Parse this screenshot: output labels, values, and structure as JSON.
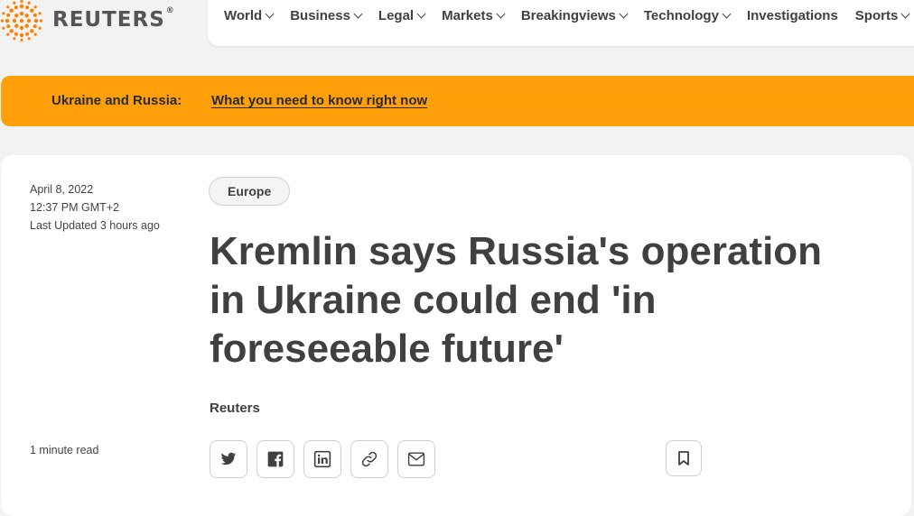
{
  "brand": {
    "name": "REUTERS",
    "reg": "®"
  },
  "nav": {
    "items": [
      {
        "label": "World",
        "dropdown": true
      },
      {
        "label": "Business",
        "dropdown": true
      },
      {
        "label": "Legal",
        "dropdown": true
      },
      {
        "label": "Markets",
        "dropdown": true
      },
      {
        "label": "Breakingviews",
        "dropdown": true
      },
      {
        "label": "Technology",
        "dropdown": true
      },
      {
        "label": "Investigations",
        "dropdown": false
      },
      {
        "label": "Sports",
        "dropdown": true
      }
    ]
  },
  "banner": {
    "label": "Ukraine and Russia:",
    "link": "What you need to know right now",
    "color": "#ffa00a"
  },
  "article": {
    "date": "April 8, 2022",
    "time": "12:37 PM GMT+2",
    "updated": "Last Updated 3 hours ago",
    "read_time": "1 minute read",
    "tag": "Europe",
    "headline": "Kremlin says Russia's operation in Ukraine could end 'in foreseeable future'",
    "byline": "Reuters"
  },
  "share": [
    "twitter-icon",
    "facebook-icon",
    "linkedin-icon",
    "link-icon",
    "email-icon"
  ],
  "bookmark_icon": "bookmark-icon"
}
